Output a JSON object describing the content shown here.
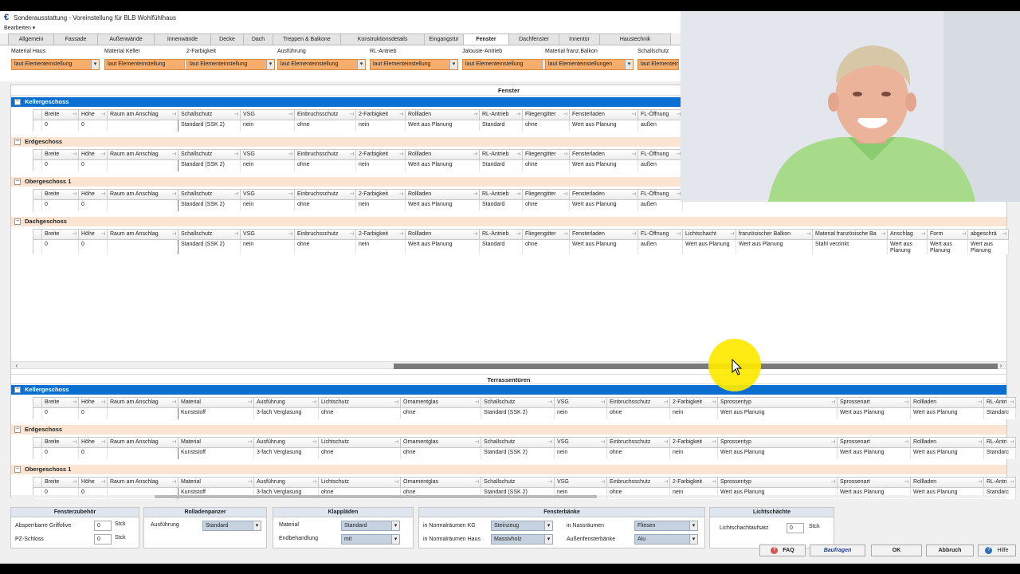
{
  "window": {
    "title": "Sonderausstattung - Voreinstellung für BLB Wohlfühlhaus",
    "menu": "Bearbeiten ▾"
  },
  "tabs": [
    "Allgemein",
    "Fassade",
    "Außenwände",
    "Innenwände",
    "Decke",
    "Dach",
    "Treppen & Balkone",
    "Konstruktionsdetails",
    "Eingangstür",
    "Fenster",
    "Dachfenster",
    "Innentür",
    "Haustechnik"
  ],
  "active_tab": "Fenster",
  "top_fields": [
    {
      "label": "Material Haus",
      "value": "laut Elementeinstellung"
    },
    {
      "label": "Material Keller",
      "value": "laut Elementeinstellung"
    },
    {
      "label": "2-Farbigkeit",
      "value": "laut Elementeinstellung"
    },
    {
      "label": "Ausführung",
      "value": "laut Elementeinstellung"
    },
    {
      "label": "RL-Antrieb",
      "value": "laut Elementeinstellung"
    },
    {
      "label": "Jalousie-Antrieb",
      "value": "laut Elementeinstellung"
    },
    {
      "label": "Material franz.Balkon",
      "value": "laut Elementeinstellungen"
    },
    {
      "label": "Schallschutz",
      "value": "laut Elementeinstellung"
    }
  ],
  "fenster": {
    "title": "Fenster",
    "columns": [
      "Breite",
      "Höhe",
      "Raum am Anschlag",
      "Schallschutz",
      "VSG",
      "Einbruchsschutz",
      "2-Farbigkeit",
      "Rollladen",
      "RL-Antrieb",
      "Fliegengitter",
      "Fensterladen",
      "FL-Öffnung"
    ],
    "values": [
      "0",
      "0",
      "",
      "Standard (SSK 2)",
      "nein",
      "ohne",
      "nein",
      "Wert aus Planung",
      "Standard",
      "ohne",
      "Wert aus Planung",
      "außen"
    ],
    "extra_columns": [
      "Lichtschacht",
      "französischer Balkon",
      "Material französische Ba",
      "Anschlag",
      "Form",
      "abgeschrä"
    ],
    "extra_values": [
      "Wert aus Planung",
      "Wert aus Planung",
      "Stahl verzinkt",
      "Wert aus Planung",
      "Wert aus Planung",
      "Wert aus Planung"
    ],
    "floors": [
      "Kellergeschoss",
      "Erdgeschoss",
      "Obergeschoss 1",
      "Dachgeschoss"
    ]
  },
  "terrasse": {
    "title": "Terrassentüren",
    "columns": [
      "Breite",
      "Höhe",
      "Raum am Anschlag",
      "Material",
      "Ausführung",
      "Lichtschutz",
      "Ornamentglas",
      "Schallschutz",
      "VSG",
      "Einbruchsschutz",
      "2-Farbigkeit",
      "Sprossentyp",
      "Sprossenart",
      "Rollladen",
      "RL-Antri"
    ],
    "values": [
      "0",
      "0",
      "",
      "Kunststoff",
      "3-fach Verglasung",
      "ohne",
      "ohne",
      "Standard (SSK 2)",
      "nein",
      "ohne",
      "nein",
      "Wert aus Planung",
      "Wert aus Planung",
      "Wert aus Planung",
      "Standarc"
    ],
    "floors": [
      "Kellergeschoss",
      "Erdgeschoss",
      "Obergeschoss 1"
    ]
  },
  "bottom": {
    "fensterzubehoer": {
      "title": "Fensterzubehör",
      "rows": [
        {
          "label": "Absperrbarre Griffolive",
          "value": "0",
          "unit": "Stck"
        },
        {
          "label": "PZ-Schloss",
          "value": "0",
          "unit": "Stck"
        }
      ]
    },
    "rolladenpanzer": {
      "title": "Rolladenpanzer",
      "label": "Ausführung",
      "value": "Standard"
    },
    "klapplaeden": {
      "title": "Klappläden",
      "rows": [
        {
          "label": "Material",
          "value": "Standard"
        },
        {
          "label": "Endbehandlung",
          "value": "mit"
        }
      ]
    },
    "fensterbaenke": {
      "title": "Fensterbänke",
      "rows": [
        {
          "label": "in Normalräumen KG",
          "value": "Steinzeug"
        },
        {
          "label": "in Normalräumen Haus",
          "value": "Massivholz"
        },
        {
          "label": "in Nassräumen",
          "value": "Fliesen"
        },
        {
          "label": "Außenfensterbänke",
          "value": "Alu"
        }
      ]
    },
    "lichtschaechte": {
      "title": "Lichtschächte",
      "label": "Lichtschachtaufsatz",
      "value": "0",
      "unit": "Stck"
    }
  },
  "buttons": {
    "faq": "FAQ",
    "baufragen": "Baufragen",
    "ok": "OK",
    "abbruch": "Abbruch",
    "hilfe": "Hilfe"
  }
}
